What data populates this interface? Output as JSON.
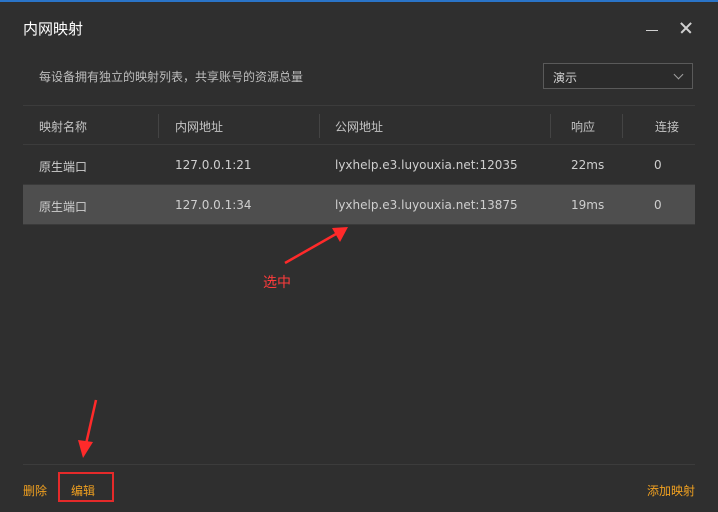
{
  "window": {
    "title": "内网映射"
  },
  "description": "每设备拥有独立的映射列表，共享账号的资源总量",
  "device_select": {
    "value": "演示"
  },
  "table": {
    "headers": [
      "映射名称",
      "内网地址",
      "公网地址",
      "响应",
      "连接"
    ],
    "rows": [
      {
        "name": "原生端口",
        "local": "127.0.0.1:21",
        "public": "lyxhelp.e3.luyouxia.net:12035",
        "response": "22ms",
        "connections": "0",
        "selected": false
      },
      {
        "name": "原生端口",
        "local": "127.0.0.1:34",
        "public": "lyxhelp.e3.luyouxia.net:13875",
        "response": "19ms",
        "connections": "0",
        "selected": true
      }
    ]
  },
  "annotation": {
    "selected_label": "选中",
    "color": "#ff3b3b"
  },
  "footer": {
    "delete_label": "删除",
    "edit_label": "编辑",
    "add_label": "添加映射",
    "link_color": "#f0a020"
  },
  "colors": {
    "background": "#2f2f2f",
    "selected_row": "#4e4e4e",
    "highlight_box": "#e52a2a"
  }
}
